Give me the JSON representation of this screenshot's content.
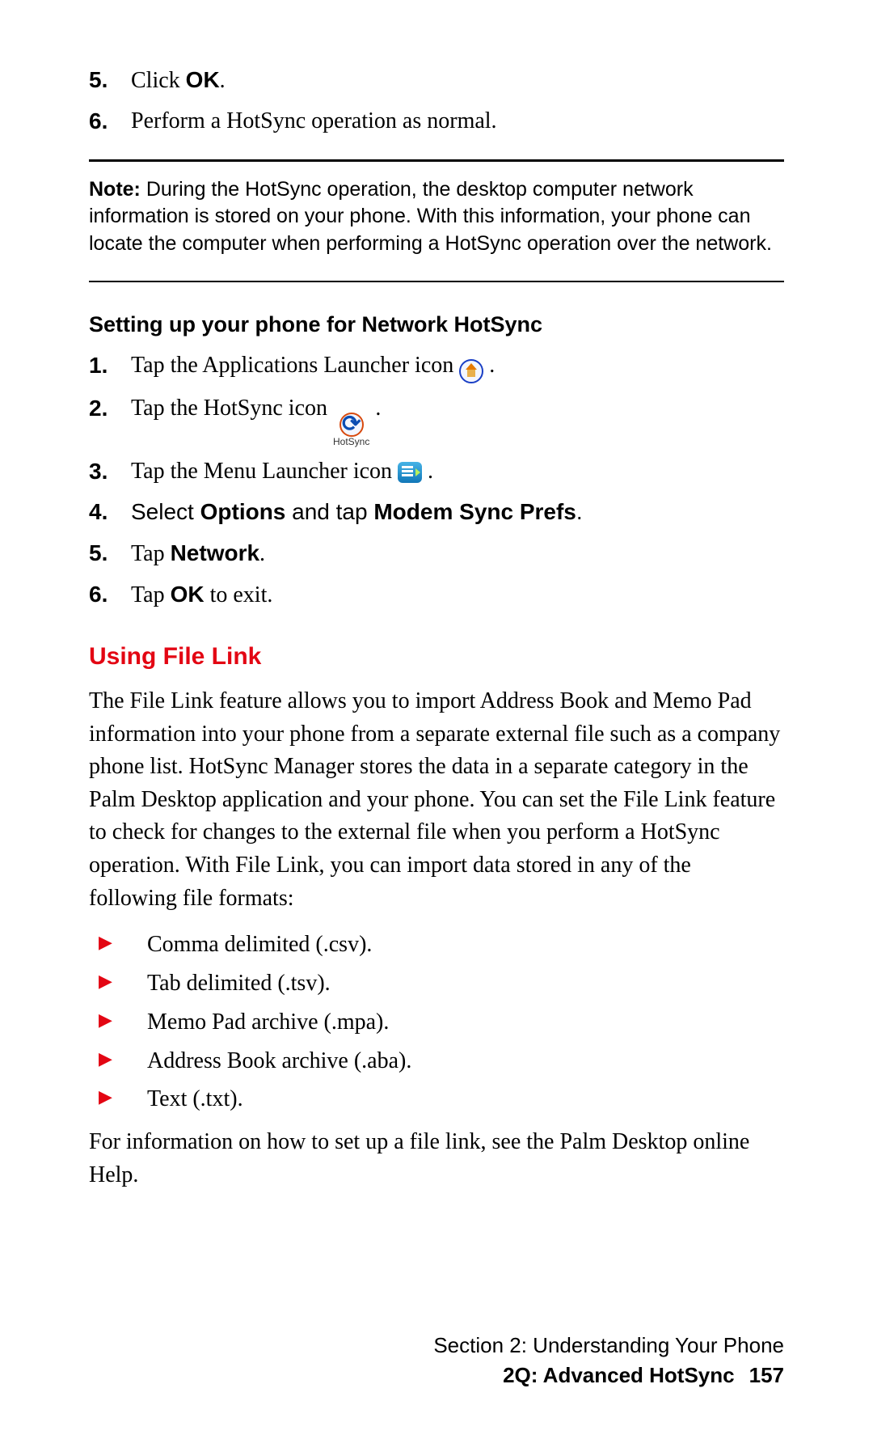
{
  "top_steps": [
    {
      "num": "5.",
      "parts": [
        {
          "t": "Click "
        },
        {
          "t": "OK",
          "bold": true
        },
        {
          "t": "."
        }
      ]
    },
    {
      "num": "6.",
      "parts": [
        {
          "t": "Perform a HotSync operation as normal."
        }
      ]
    }
  ],
  "note": {
    "label": "Note:",
    "text": " During the HotSync operation, the desktop computer network information is stored on your phone. With this information, your phone can locate the computer when performing a HotSync operation over the network."
  },
  "sub_heading": "Setting up your phone for Network HotSync",
  "setup_steps": [
    {
      "num": "1.",
      "parts": [
        {
          "t": "Tap the Applications Launcher icon "
        },
        {
          "icon": "launcher"
        },
        {
          "t": " ."
        }
      ]
    },
    {
      "num": "2.",
      "parts": [
        {
          "t": "Tap the HotSync icon "
        },
        {
          "icon": "hotsync"
        },
        {
          "t": " ."
        }
      ]
    },
    {
      "num": "3.",
      "parts": [
        {
          "t": "Tap the Menu Launcher icon "
        },
        {
          "icon": "menu"
        },
        {
          "t": " ."
        }
      ]
    },
    {
      "num": "4.",
      "num_style": "sans",
      "parts": [
        {
          "t": "Select "
        },
        {
          "t": "Options",
          "bold": true
        },
        {
          "t": " and tap "
        },
        {
          "t": "Modem Sync Prefs",
          "bold": true
        },
        {
          "t": "."
        }
      ],
      "body_style": "sans"
    },
    {
      "num": "5.",
      "parts": [
        {
          "t": "Tap "
        },
        {
          "t": "Network",
          "bold": true
        },
        {
          "t": "."
        }
      ]
    },
    {
      "num": "6.",
      "parts": [
        {
          "t": "Tap "
        },
        {
          "t": "OK",
          "bold": true
        },
        {
          "t": " to exit."
        }
      ]
    }
  ],
  "heading_red": "Using File Link",
  "file_link_para": "The File Link feature allows you to import Address Book and Memo Pad information into your phone from a separate external file such as a company phone list. HotSync Manager stores the data in a separate category in the Palm Desktop application and your phone. You can set the File Link feature to check for changes to the external file when you perform a HotSync operation. With File Link, you can import data stored in any of the following file formats:",
  "bullets": [
    "Comma delimited (.csv).",
    "Tab delimited (.tsv).",
    "Memo Pad archive (.mpa).",
    "Address Book archive (.aba).",
    "Text (.txt)."
  ],
  "closing_para": "For information on how to set up a file link, see the Palm Desktop online Help.",
  "hotsync_icon_label": "HotSync",
  "footer": {
    "line1": "Section 2: Understanding Your Phone",
    "line2_title": "2Q: Advanced HotSync",
    "page_number": "157"
  }
}
